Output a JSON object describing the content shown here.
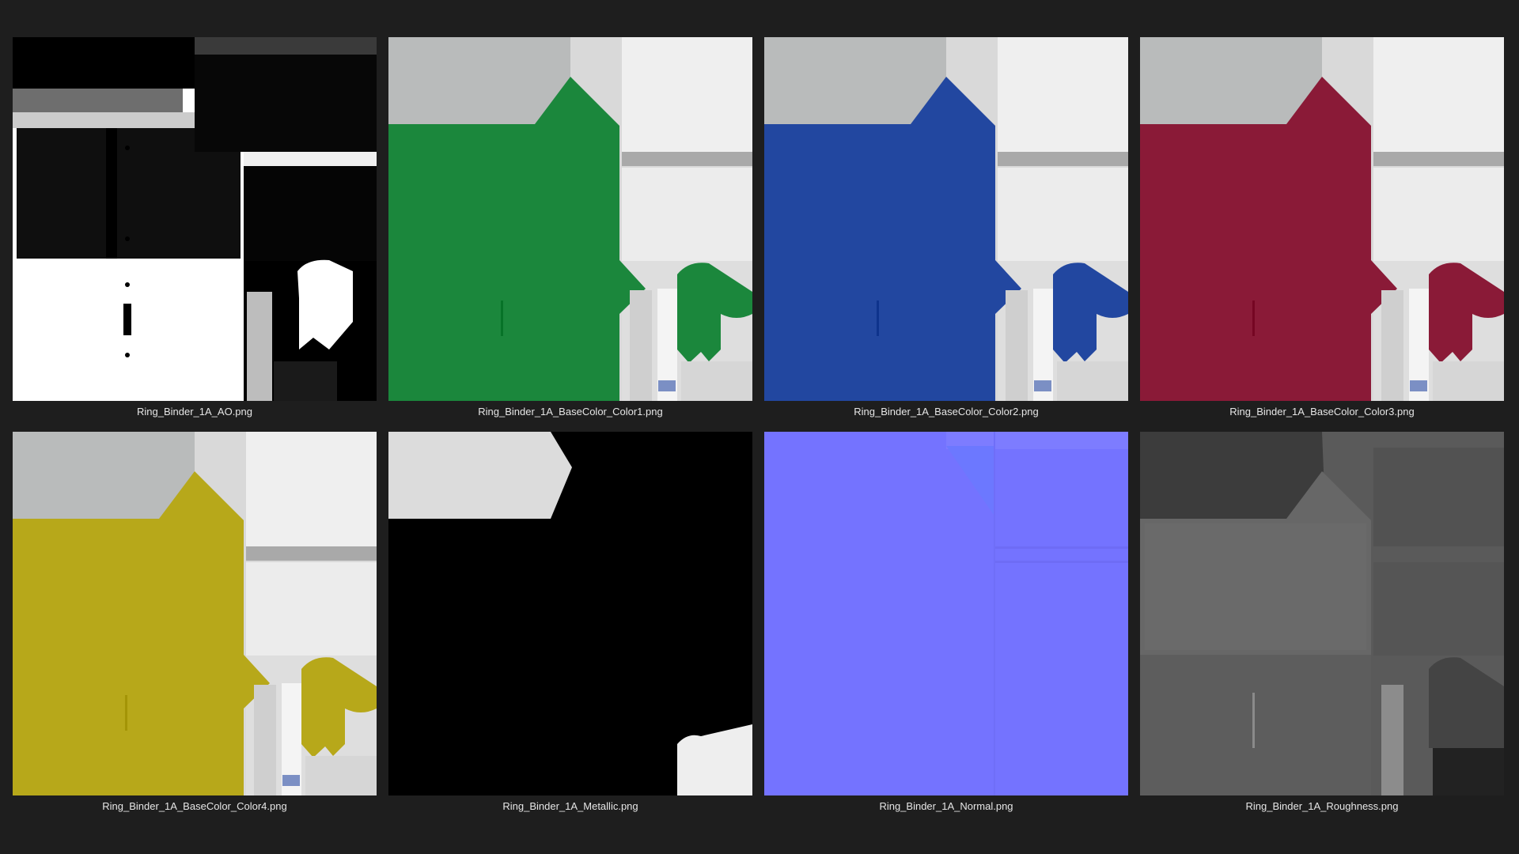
{
  "window": {
    "background_color": "#1e1e1e"
  },
  "thumbnails": [
    {
      "filename": "Ring_Binder_1A_AO.png",
      "kind": "ao",
      "color": "#000000"
    },
    {
      "filename": "Ring_Binder_1A_BaseColor_Color1.png",
      "kind": "base",
      "color": "#1b873c"
    },
    {
      "filename": "Ring_Binder_1A_BaseColor_Color2.png",
      "kind": "base",
      "color": "#2247a0"
    },
    {
      "filename": "Ring_Binder_1A_BaseColor_Color3.png",
      "kind": "base",
      "color": "#8a1a37"
    },
    {
      "filename": "Ring_Binder_1A_BaseColor_Color4.png",
      "kind": "base",
      "color": "#b7a81a"
    },
    {
      "filename": "Ring_Binder_1A_Metallic.png",
      "kind": "metallic",
      "color": "#000000"
    },
    {
      "filename": "Ring_Binder_1A_Normal.png",
      "kind": "normal",
      "color": "#7473ff"
    },
    {
      "filename": "Ring_Binder_1A_Roughness.png",
      "kind": "roughness",
      "color": "#6b6b6b"
    }
  ]
}
